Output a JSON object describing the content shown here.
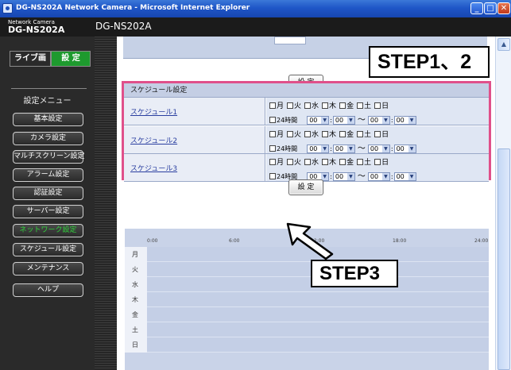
{
  "window": {
    "title": "DG-NS202A Network Camera - Microsoft Internet Explorer",
    "minimize": "_",
    "maximize": "□",
    "close": "✕"
  },
  "header": {
    "brand_small": "Network Camera",
    "brand_model": "DG-NS202A",
    "model": "DG-NS202A"
  },
  "sidebar": {
    "live_label": "ライブ画",
    "setup_label": "設 定",
    "menu_title": "設定メニュー",
    "items": [
      {
        "label": "基本設定"
      },
      {
        "label": "カメラ設定"
      },
      {
        "label": "マルチスクリーン設定"
      },
      {
        "label": "アラーム設定"
      },
      {
        "label": "認証設定"
      },
      {
        "label": "サーバー設定"
      },
      {
        "label": "ネットワーク設定"
      },
      {
        "label": "スケジュール設定"
      },
      {
        "label": "メンテナンス"
      },
      {
        "label": "ヘルプ"
      }
    ],
    "active_index": 6,
    "active_color": "#2fd13a"
  },
  "main": {
    "set_button_label": "設 定",
    "callout_step12": "STEP1、2",
    "callout_step3": "STEP3",
    "schedule": {
      "title": "スケジュール設定",
      "days": [
        "月",
        "火",
        "水",
        "木",
        "金",
        "土",
        "日"
      ],
      "all_day_label": "24時間",
      "time_default": "00",
      "rows": [
        {
          "label": "スケジュール1"
        },
        {
          "label": "スケジュール2"
        },
        {
          "label": "スケジュール3"
        }
      ]
    },
    "timeline": {
      "hours": [
        "0:00",
        "6:00",
        "12:00",
        "18:00",
        "24:00"
      ],
      "days": [
        "月",
        "火",
        "水",
        "木",
        "金",
        "土",
        "日"
      ]
    }
  },
  "colors": {
    "highlight_border": "#e0508a",
    "setup_active": "#1e9a2e",
    "titlebar": "#1f56c7"
  }
}
